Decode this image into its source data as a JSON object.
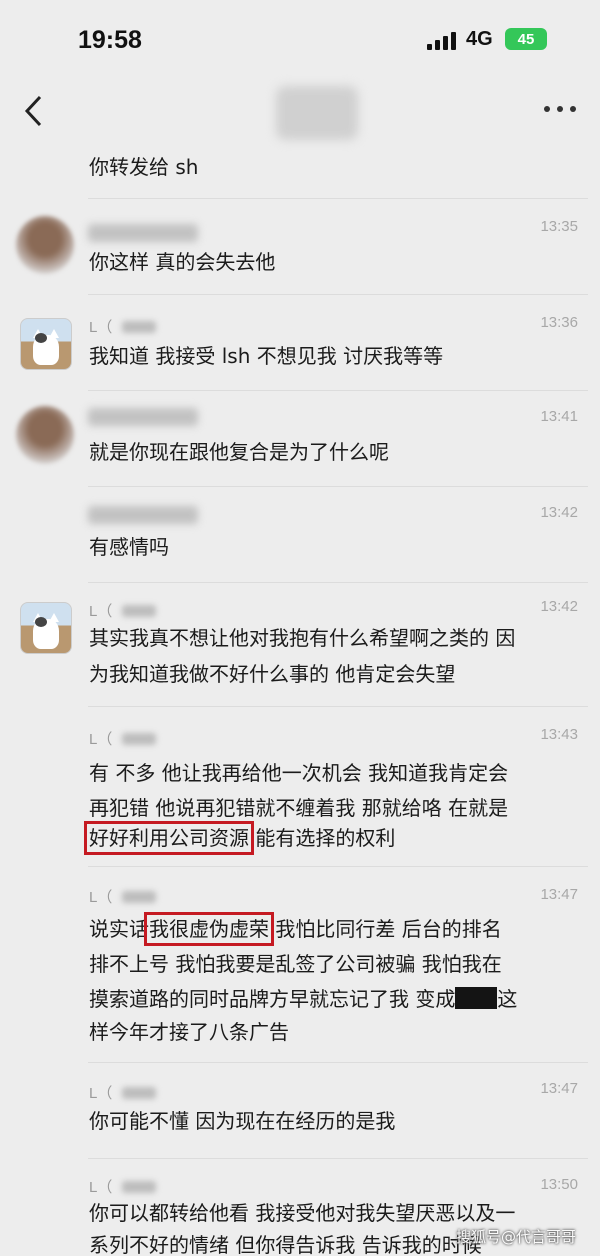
{
  "status_bar": {
    "time": "19:58",
    "network": "4G",
    "battery": "45"
  },
  "nav": {
    "back_icon": "chevron-left-icon",
    "more_icon": "ellipsis-icon"
  },
  "messages": [
    {
      "text_lines": [
        "你转发给 sh"
      ]
    },
    {
      "time": "13:35",
      "text_lines": [
        "你这样 真的会失去他"
      ]
    },
    {
      "name": "L（",
      "time": "13:36",
      "text_lines": [
        "我知道 我接受 lsh 不想见我 讨厌我等等"
      ]
    },
    {
      "time": "13:41",
      "text_lines": [
        "就是你现在跟他复合是为了什么呢"
      ]
    },
    {
      "time": "13:42",
      "text_lines": [
        "有感情吗"
      ]
    },
    {
      "name": "L（",
      "time": "13:42",
      "text_lines": [
        "其实我真不想让他对我抱有什么希望啊之类的 因",
        "为我知道我做不好什么事的 他肯定会失望"
      ]
    },
    {
      "name": "L（",
      "time": "13:43",
      "text_lines": [
        "有 不多 他让我再给他一次机会 我知道我肯定会",
        "再犯错 他说再犯错就不缠着我 那就给咯 在就是"
      ],
      "highlight": "好好利用公司资源",
      "after_highlight": " 能有选择的权利"
    },
    {
      "name": "L（",
      "time": "13:47",
      "before_highlight": "说实话",
      "highlight": "我很虚伪虚荣",
      "after_highlight": " 我怕比同行差 后台的排名",
      "text_lines": [
        "排不上号 我怕我要是乱签了公司被骗 我怕我在",
        "摸索道路的同时品牌方早就忘记了我 变成"
      ],
      "after_redact": "这",
      "last_line": "样今年才接了八条广告"
    },
    {
      "name": "L（",
      "time": "13:47",
      "text_lines": [
        "你可能不懂 因为现在在经历的是我"
      ]
    },
    {
      "name": "L（",
      "time": "13:50",
      "text_lines": [
        "你可以都转给他看 我接受他对我失望厌恶以及一",
        "系列不好的情绪 但你得告诉我 告诉我的时候"
      ]
    }
  ],
  "watermark": "搜狐号@代言哥哥"
}
